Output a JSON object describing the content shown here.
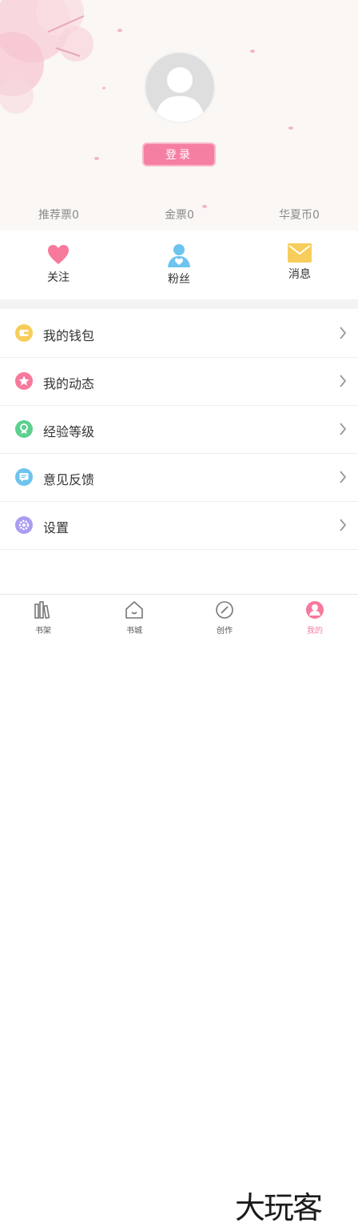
{
  "profile": {
    "login_label": "登录"
  },
  "stats": [
    {
      "label": "推荐票0"
    },
    {
      "label": "金票0"
    },
    {
      "label": "华夏币0"
    }
  ],
  "quick_actions": [
    {
      "label": "关注",
      "icon": "heart-icon",
      "color": "#f7799c"
    },
    {
      "label": "粉丝",
      "icon": "fans-icon",
      "color": "#6cc4ef"
    },
    {
      "label": "消息",
      "icon": "message-icon",
      "color": "#f7cd5b"
    }
  ],
  "menu": [
    {
      "label": "我的钱包",
      "icon": "wallet-icon",
      "color": "#f7cd5b"
    },
    {
      "label": "我的动态",
      "icon": "star-icon",
      "color": "#f7799c"
    },
    {
      "label": "经验等级",
      "icon": "medal-icon",
      "color": "#5cd18e"
    },
    {
      "label": "意见反馈",
      "icon": "feedback-icon",
      "color": "#6cc4ef"
    },
    {
      "label": "设置",
      "icon": "gear-icon",
      "color": "#a99cf2"
    }
  ],
  "tabbar": [
    {
      "label": "书架",
      "icon": "bookshelf-icon"
    },
    {
      "label": "书城",
      "icon": "home-icon"
    },
    {
      "label": "创作",
      "icon": "create-icon"
    },
    {
      "label": "我的",
      "icon": "profile-icon",
      "active": true
    }
  ],
  "colors": {
    "accent": "#f57fa2",
    "header_bg": "#faf7f5",
    "divider_bg": "#f3f3f3"
  },
  "watermark": {
    "text": "大玩客"
  }
}
